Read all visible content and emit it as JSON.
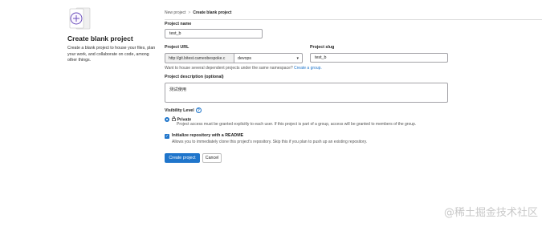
{
  "left": {
    "title": "Create blank project",
    "description": "Create a blank project to house your files, plan your work, and collaborate on code, among other things."
  },
  "breadcrumb": {
    "parent": "New project",
    "separator": ">",
    "current": "Create blank project"
  },
  "form": {
    "project_name": {
      "label": "Project name",
      "value": "test_b"
    },
    "project_url": {
      "label": "Project URL",
      "prefix": "http://git.bitest.cameobespoke.c",
      "namespace": "devops"
    },
    "project_slug": {
      "label": "Project slug",
      "value": "test_b"
    },
    "namespace_hint": {
      "text": "Want to house several dependent projects under the same namespace?",
      "link": "Create a group."
    },
    "description": {
      "label": "Project description (optional)",
      "value": "测试使用"
    },
    "visibility": {
      "label": "Visibility Level",
      "help": "?",
      "option_title": "Private",
      "option_desc": "Project access must be granted explicitly to each user. If this project is part of a group, access will be granted to members of the group."
    },
    "init_readme": {
      "title": "Initialize repository with a README",
      "desc": "Allows you to immediately clone this project's repository. Skip this if you plan to push up an existing repository."
    },
    "submit_label": "Create project",
    "cancel_label": "Cancel"
  },
  "watermark": "@稀土掘金技术社区",
  "colors": {
    "accent": "#1f75cb",
    "border": "#a4a3a8",
    "text": "#303030"
  },
  "icons": {
    "illustration": "plus-circle-illustration",
    "lock": "lock-icon",
    "help": "question-circle-icon",
    "dropdown": "chevron-down-icon"
  }
}
